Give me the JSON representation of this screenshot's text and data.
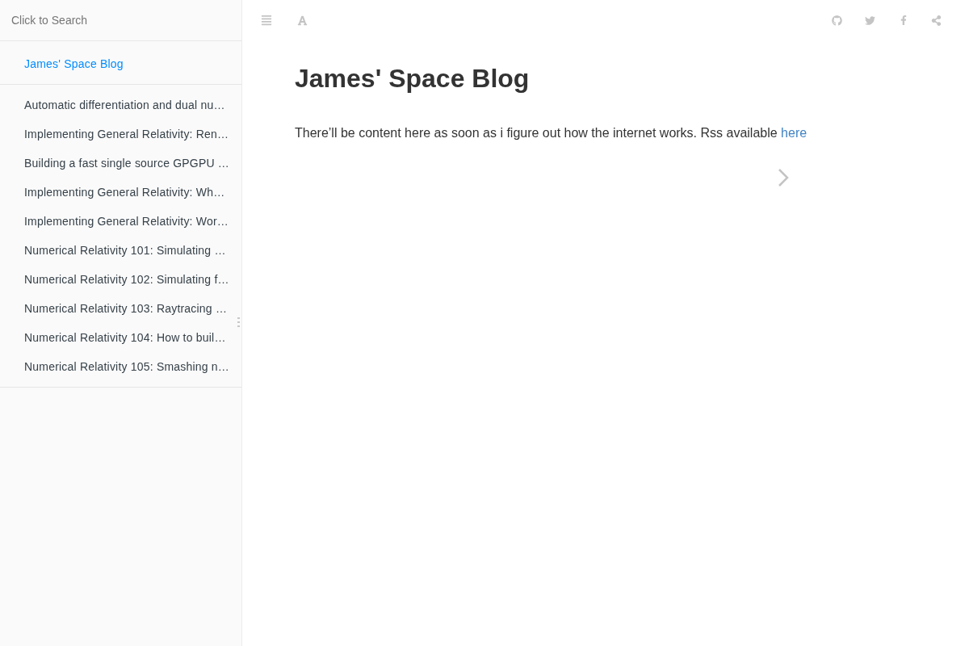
{
  "sidebar": {
    "search": {
      "placeholder": "Click to Search"
    },
    "chapters": [
      {
        "label": "James' Space Blog",
        "selected": true
      }
    ],
    "articles": [
      {
        "label": "Automatic differentiation and dual nu…",
        "selected": false
      },
      {
        "label": "Implementing General Relativity: Ren…",
        "selected": false
      },
      {
        "label": "Building a fast single source GPGPU …",
        "selected": false
      },
      {
        "label": "Implementing General Relativity: Wh…",
        "selected": false
      },
      {
        "label": "Implementing General Relativity: Wor…",
        "selected": false
      },
      {
        "label": "Numerical Relativity 101: Simulating …",
        "selected": false
      },
      {
        "label": "Numerical Relativity 102: Simulating f…",
        "selected": false
      },
      {
        "label": "Numerical Relativity 103: Raytracing …",
        "selected": false
      },
      {
        "label": "Numerical Relativity 104: How to buil…",
        "selected": false
      },
      {
        "label": "Numerical Relativity 105: Smashing n…",
        "selected": false
      }
    ]
  },
  "page": {
    "title": "James' Space Blog",
    "paragraph": {
      "text": "There’ll be content here as soon as i figure out how the internet works. Rss available",
      "link": "here"
    }
  }
}
